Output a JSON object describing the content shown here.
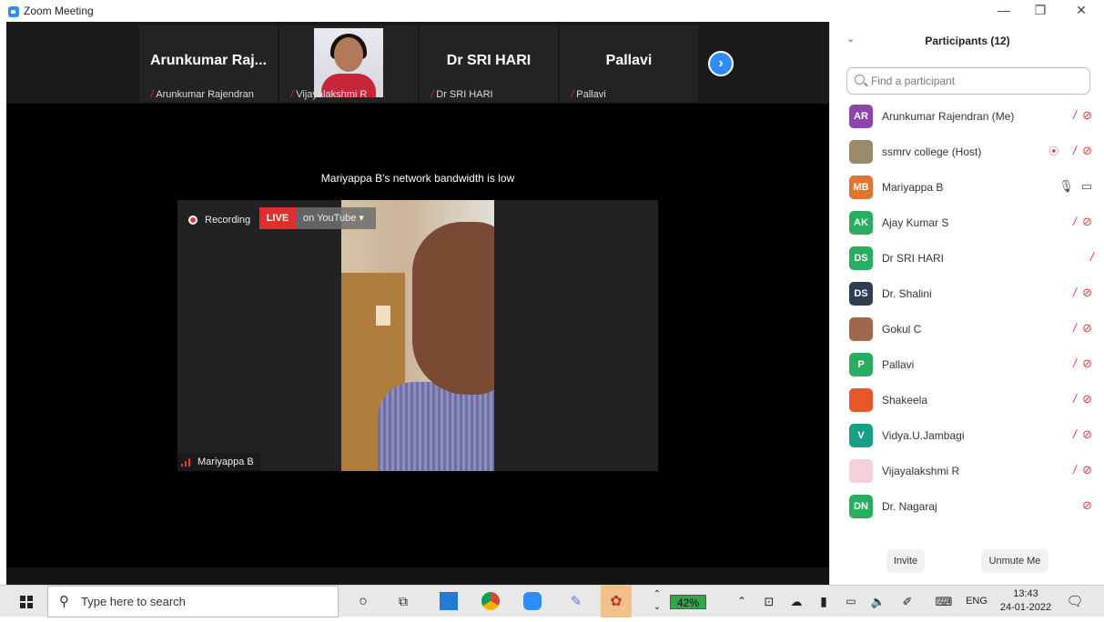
{
  "window": {
    "title": "Zoom Meeting",
    "minimize": "—",
    "restore": "❐",
    "close": "✕"
  },
  "strip": {
    "tiles": [
      {
        "big_name": "Arunkumar  Raj...",
        "label": "Arunkumar Rajendran"
      },
      {
        "big_name": "",
        "label": "Vijayalakshmi R"
      },
      {
        "big_name": "Dr SRI HARI",
        "label": "Dr SRI HARI"
      },
      {
        "big_name": "Pallavi",
        "label": "Pallavi"
      }
    ],
    "next_icon": "›"
  },
  "notice": "Mariyappa B's network bandwidth is low",
  "main_video": {
    "recording_label": "Recording",
    "live_label": "LIVE",
    "youtube_label": "on YouTube  ▾",
    "speaker_name": "Mariyappa B"
  },
  "participants": {
    "header": "Participants (12)",
    "collapse_icon": "⌄",
    "search_placeholder": "Find a participant",
    "list": [
      {
        "initials": "AR",
        "color": "#8e44ad",
        "name": "Arunkumar Rajendran (Me)",
        "mic": "off",
        "cam": "off"
      },
      {
        "initials": "",
        "color": "#9a8a6a",
        "name": "ssmrv college (Host)",
        "mic": "off",
        "cam": "off",
        "recording": true
      },
      {
        "initials": "MB",
        "color": "#e0762d",
        "name": "Mariyappa B",
        "mic": "on",
        "cam": "on"
      },
      {
        "initials": "AK",
        "color": "#27ae60",
        "name": "Ajay Kumar S",
        "mic": "off",
        "cam": "off"
      },
      {
        "initials": "DS",
        "color": "#27ae60",
        "name": "Dr SRI HARI",
        "mic": "off",
        "cam": "none"
      },
      {
        "initials": "DS",
        "color": "#2c3e50",
        "name": "Dr. Shalini",
        "mic": "off",
        "cam": "off"
      },
      {
        "initials": "",
        "color": "#a0674a",
        "name": "Gokul C",
        "mic": "off",
        "cam": "off"
      },
      {
        "initials": "P",
        "color": "#27ae60",
        "name": "Pallavi",
        "mic": "off",
        "cam": "off"
      },
      {
        "initials": "",
        "color": "#e8572a",
        "name": "Shakeela",
        "mic": "off",
        "cam": "off"
      },
      {
        "initials": "V",
        "color": "#16a085",
        "name": "Vidya.U.Jambagi",
        "mic": "off",
        "cam": "off"
      },
      {
        "initials": "",
        "color": "#f3d1d6",
        "name": "Vijayalakshmi R",
        "mic": "off",
        "cam": "off"
      },
      {
        "initials": "DN",
        "color": "#27ae60",
        "name": "Dr. Nagaraj",
        "mic": "none",
        "cam": "off"
      }
    ],
    "invite_label": "Invite",
    "unmute_label": "Unmute Me"
  },
  "taskbar": {
    "search_placeholder": "Type here to search",
    "battery": "42%",
    "language": "ENG",
    "time": "13:43",
    "date": "24-01-2022"
  }
}
